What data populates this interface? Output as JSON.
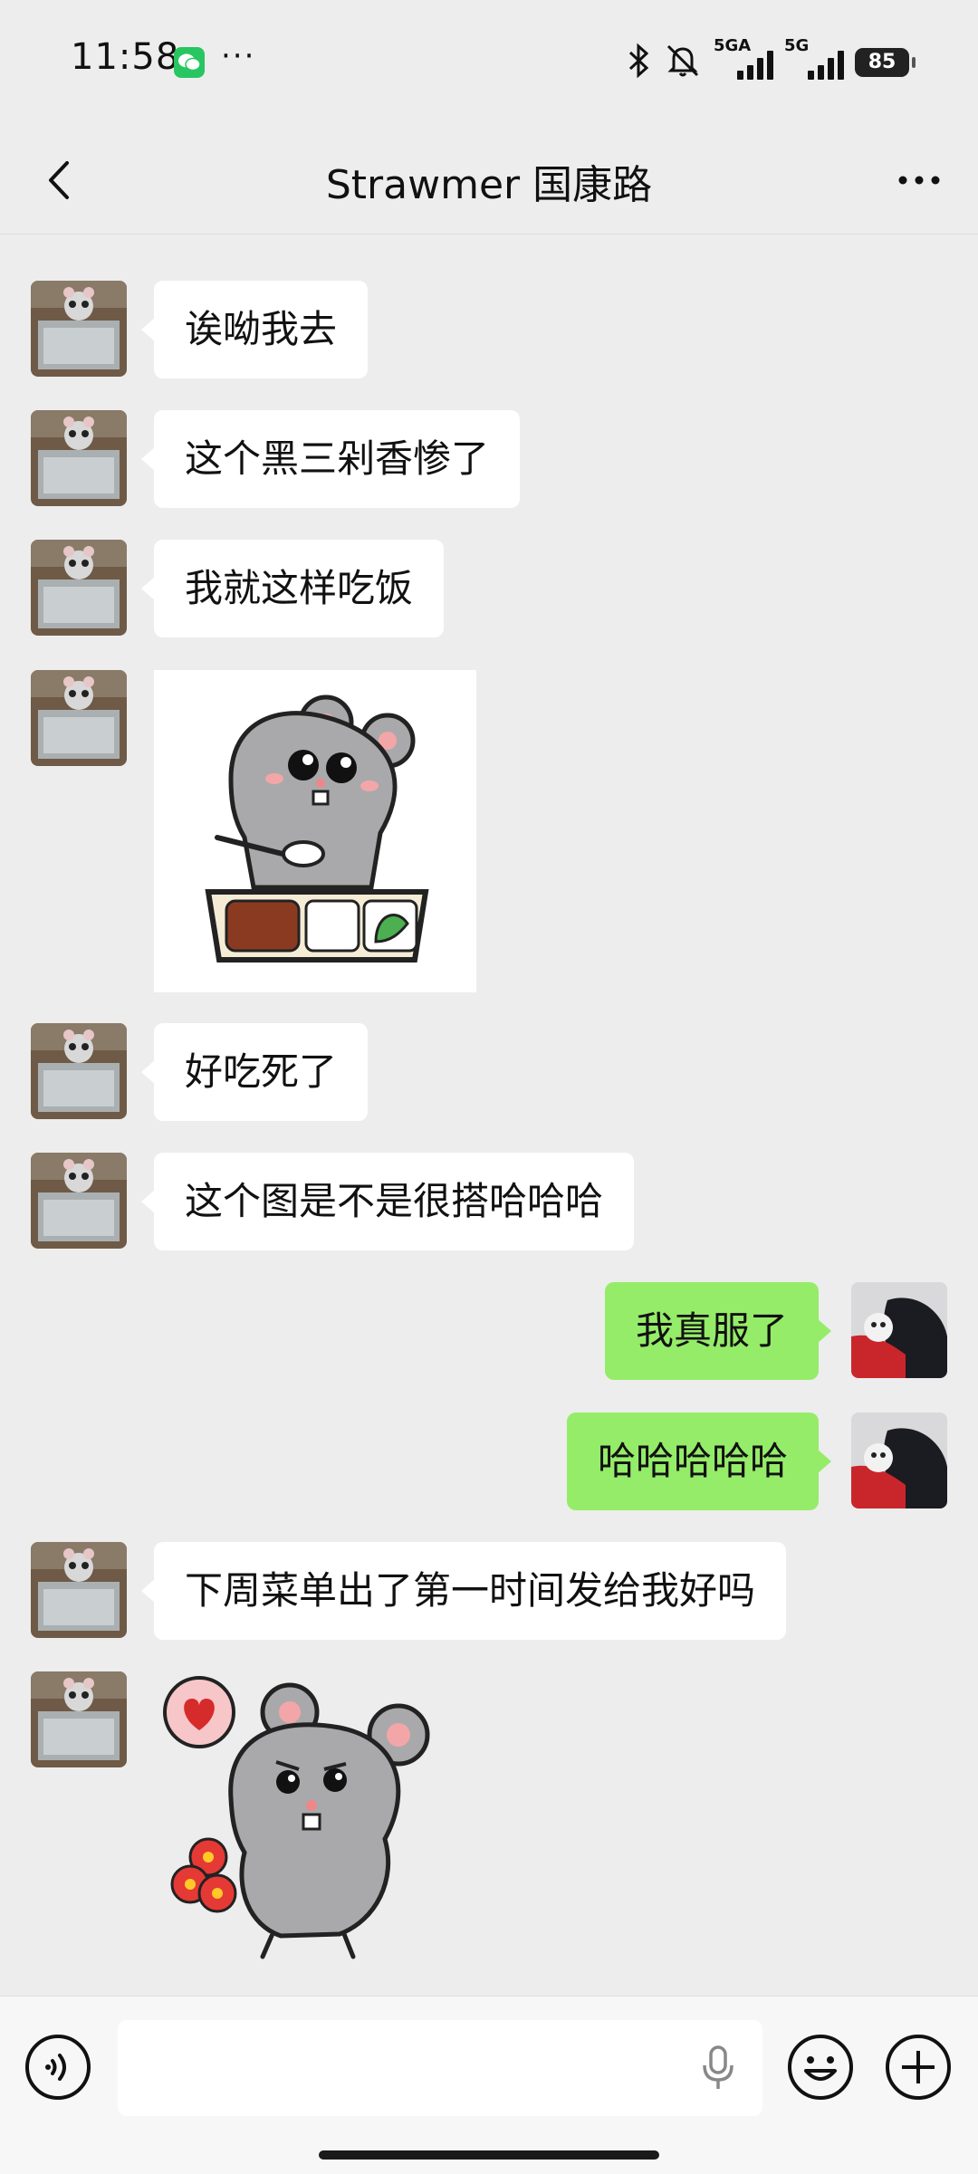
{
  "status_bar": {
    "time": "11:58",
    "more_dots": "···",
    "signal1_label": "5GA",
    "signal2_label": "5G",
    "battery": "85"
  },
  "header": {
    "title": "Strawmer 国康路"
  },
  "messages": [
    {
      "side": "left",
      "type": "text",
      "text": "诶呦我去"
    },
    {
      "side": "left",
      "type": "text",
      "text": "这个黑三剁香惨了"
    },
    {
      "side": "left",
      "type": "text",
      "text": "我就这样吃饭"
    },
    {
      "side": "left",
      "type": "sticker",
      "icon": "mouse-eating-bento-sticker"
    },
    {
      "side": "left",
      "type": "text",
      "text": "好吃死了"
    },
    {
      "side": "left",
      "type": "text",
      "text": "这个图是不是很搭哈哈哈"
    },
    {
      "side": "right",
      "type": "text",
      "text": "我真服了"
    },
    {
      "side": "right",
      "type": "text",
      "text": "哈哈哈哈哈"
    },
    {
      "side": "left",
      "type": "text",
      "text": "下周菜单出了第一时间发给我好吗"
    },
    {
      "side": "left",
      "type": "sticker",
      "icon": "mouse-flowers-heart-sticker"
    }
  ],
  "input": {
    "value": "",
    "placeholder": ""
  },
  "colors": {
    "background": "#ededed",
    "incoming_bubble": "#ffffff",
    "outgoing_bubble": "#95ec69",
    "wechat_green": "#27c660"
  }
}
